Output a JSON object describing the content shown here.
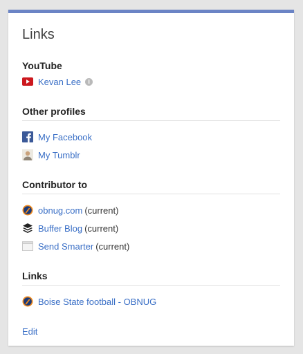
{
  "card": {
    "title": "Links"
  },
  "youtube": {
    "heading": "YouTube",
    "item": {
      "label": "Kevan Lee",
      "icon": "youtube-icon",
      "info_icon": "info-icon"
    }
  },
  "other_profiles": {
    "heading": "Other profiles",
    "items": [
      {
        "label": "My Facebook",
        "icon": "facebook-icon"
      },
      {
        "label": "My Tumblr",
        "icon": "avatar-icon"
      }
    ]
  },
  "contributor": {
    "heading": "Contributor to",
    "items": [
      {
        "label": "obnug.com",
        "suffix": "(current)",
        "icon": "obnug-icon"
      },
      {
        "label": "Buffer Blog",
        "suffix": "(current)",
        "icon": "buffer-icon"
      },
      {
        "label": "Send Smarter",
        "suffix": "(current)",
        "icon": "page-icon"
      }
    ]
  },
  "links": {
    "heading": "Links",
    "items": [
      {
        "label": "Boise State football - OBNUG",
        "icon": "obnug-icon"
      }
    ]
  },
  "edit_label": "Edit",
  "colors": {
    "accent_bar": "#6b84c5",
    "link": "#3a6fc6",
    "youtube": "#cc181e",
    "facebook": "#3b5998"
  }
}
